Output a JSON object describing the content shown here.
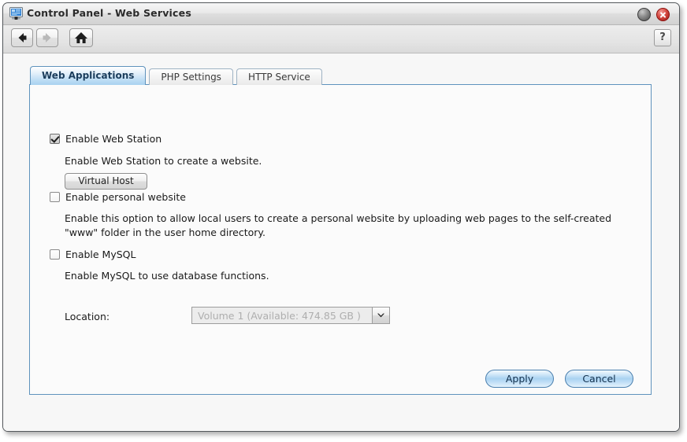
{
  "window": {
    "title": "Control Panel - Web Services",
    "icon": "control-panel-icon",
    "minimize_label": "",
    "close_label": ""
  },
  "toolbar": {
    "back_icon": "arrow-left-icon",
    "forward_icon": "arrow-right-icon",
    "home_icon": "home-icon",
    "help_label": "?"
  },
  "tabs": [
    {
      "label": "Web Applications",
      "active": true
    },
    {
      "label": "PHP Settings",
      "active": false
    },
    {
      "label": "HTTP Service",
      "active": false
    }
  ],
  "options": {
    "web_station": {
      "label": "Enable Web Station",
      "checked": true,
      "description": "Enable Web Station to create a website.",
      "button_label": "Virtual Host"
    },
    "personal_website": {
      "label": "Enable personal website",
      "checked": false,
      "description": "Enable this option to allow local users to create a personal website by uploading web pages to the self-created \"www\" folder in the user home directory."
    },
    "mysql": {
      "label": "Enable MySQL",
      "checked": false,
      "description": "Enable MySQL to use database functions.",
      "location_label": "Location:",
      "location_value": "Volume 1 (Available: 474.85 GB )",
      "location_options": [
        "Volume 1 (Available: 474.85 GB )"
      ],
      "location_disabled": true
    }
  },
  "footer": {
    "apply_label": "Apply",
    "cancel_label": "Cancel"
  },
  "colors": {
    "accent": "#5f93bd",
    "tab_active": "#a8d2f0",
    "close_button": "#d64a42",
    "panel_background": "#fbfbfb"
  }
}
